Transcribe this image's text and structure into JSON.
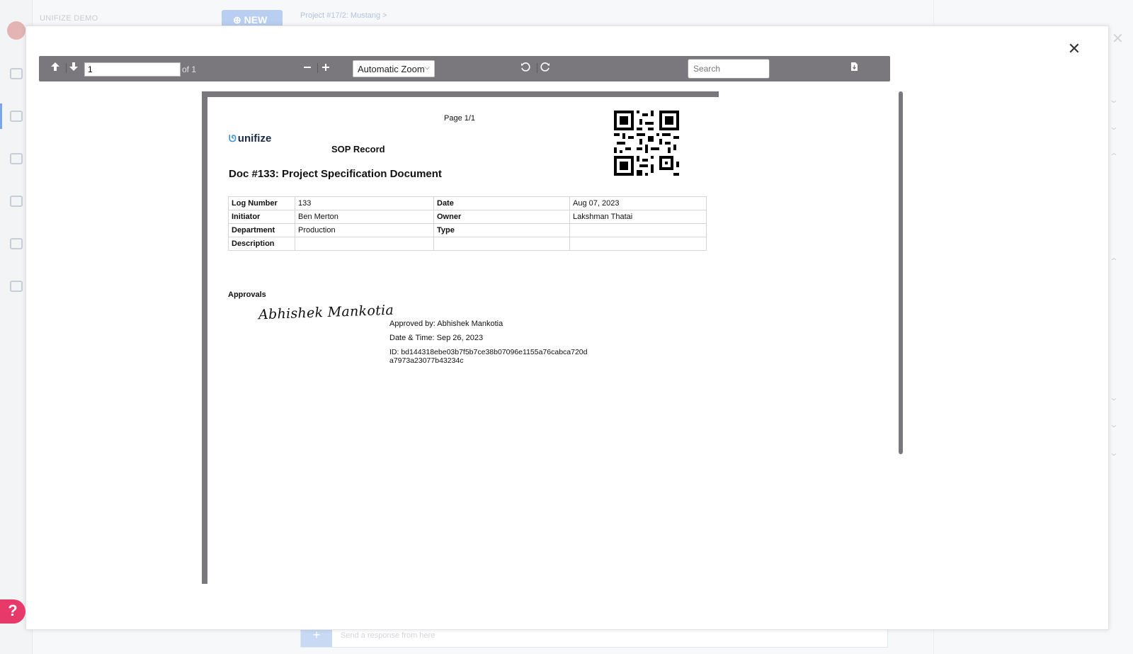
{
  "background": {
    "org_name": "UNIFIZE DEMO",
    "new_button": "⊕ NEW",
    "breadcrumb": "Project #17/2: Mustang >",
    "compose_placeholder": "Send a response from here"
  },
  "help_label": "?",
  "viewer": {
    "page_number": "1",
    "page_count_label": "of 1",
    "zoom": "Automatic Zoom",
    "search_placeholder": "Search"
  },
  "document": {
    "page_label": "Page 1/1",
    "logo_text": "unifize",
    "record_type": "SOP Record",
    "title": "Doc #133: Project Specification Document",
    "fields": {
      "log_number_label": "Log Number",
      "log_number": "133",
      "date_label": "Date",
      "date": "Aug 07, 2023",
      "initiator_label": "Initiator",
      "initiator": "Ben Merton",
      "owner_label": "Owner",
      "owner": "Lakshman Thatai",
      "department_label": "Department",
      "department": "Production",
      "type_label": "Type",
      "type": "",
      "description_label": "Description",
      "description": ""
    },
    "approvals": {
      "heading": "Approvals",
      "signature": "Abhishek Mankotia",
      "approved_by": "Approved by: Abhishek Mankotia",
      "date_time": "Date & Time: Sep 26, 2023",
      "id": "ID: bd144318ebe03b7f5b7ce38b07096e1155a76cabca720da7973a23077b43234c"
    }
  },
  "icons": [
    "page-up-icon",
    "page-down-icon",
    "zoom-out-icon",
    "zoom-in-icon",
    "rotate-ccw-icon",
    "rotate-cw-icon",
    "download-icon",
    "close-icon",
    "qr-code-icon"
  ]
}
